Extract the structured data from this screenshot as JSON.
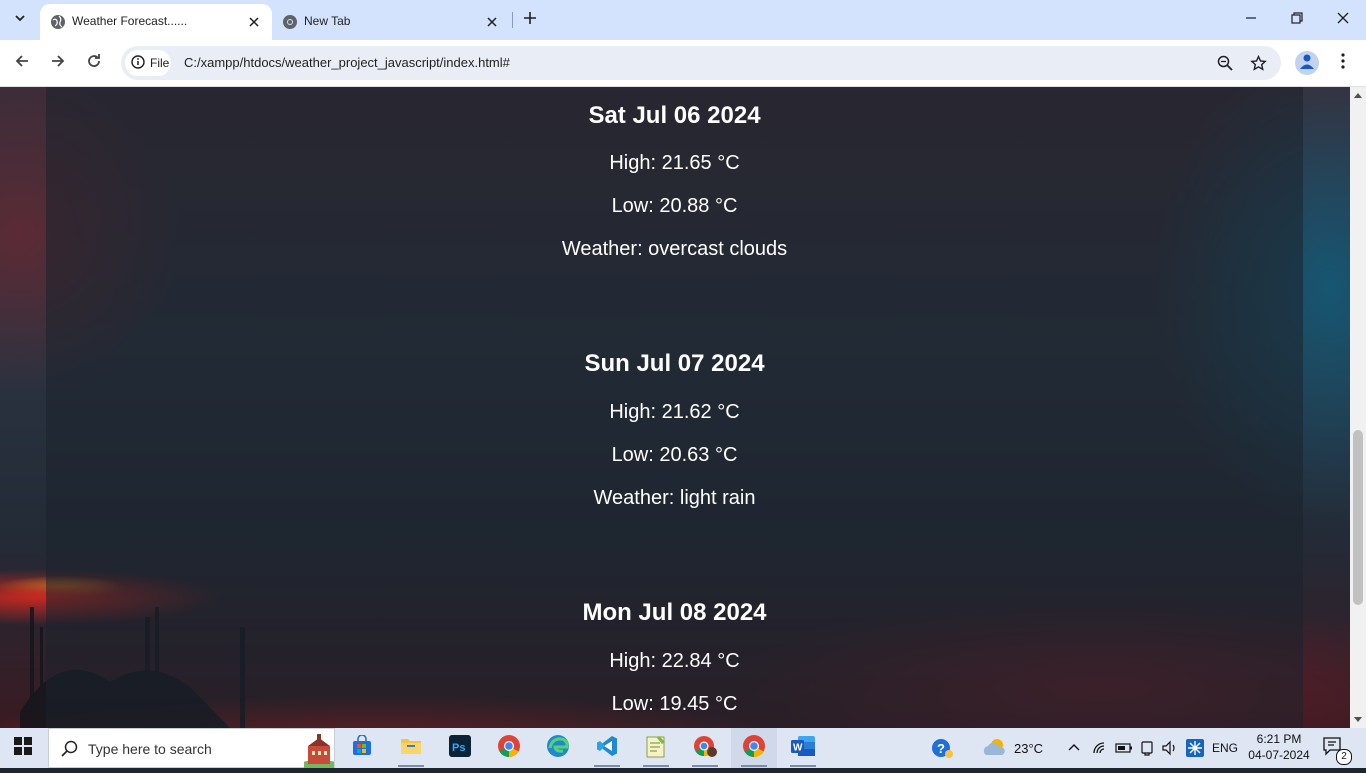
{
  "browser": {
    "tabs": [
      {
        "title": "Weather Forecast......",
        "active": true
      },
      {
        "title": "New Tab",
        "active": false
      }
    ],
    "address": {
      "scheme_chip": "File",
      "url": "C:/xampp/htdocs/weather_project_javascript/index.html#"
    }
  },
  "forecast": [
    {
      "date": "Sat Jul 06 2024",
      "high": "High: 21.65 °C",
      "low": "Low: 20.88 °C",
      "weather": "Weather: overcast clouds"
    },
    {
      "date": "Sun Jul 07 2024",
      "high": "High: 21.62 °C",
      "low": "Low: 20.63 °C",
      "weather": "Weather: light rain"
    },
    {
      "date": "Mon Jul 08 2024",
      "high": "High: 22.84 °C",
      "low": "Low: 19.45 °C"
    }
  ],
  "taskbar": {
    "search_placeholder": "Type here to search",
    "weather_temp": "23°C",
    "language": "ENG",
    "time": "6:21 PM",
    "date": "04-07-2024",
    "notifications": "2"
  }
}
